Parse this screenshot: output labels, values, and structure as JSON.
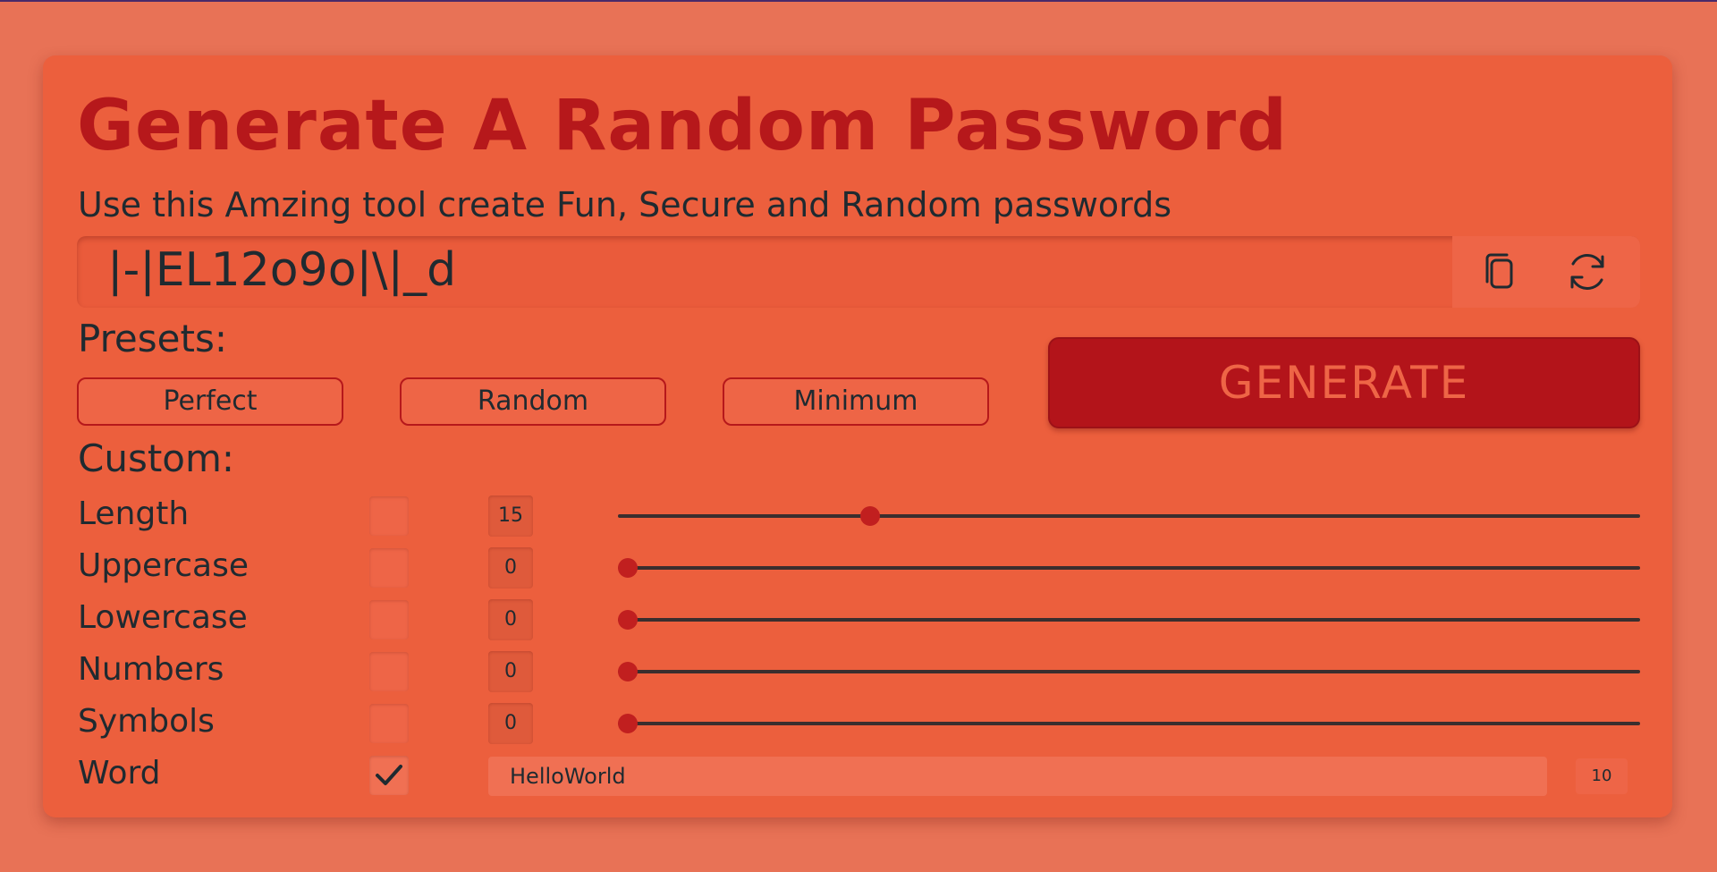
{
  "header": {
    "title": "Generate A Random Password",
    "subtitle": "Use this Amzing tool create Fun, Secure and Random passwords"
  },
  "password": {
    "value": "|-|EL12o9o|\\|_d",
    "copy_icon": "copy-icon",
    "refresh_icon": "refresh-icon"
  },
  "presets": {
    "label": "Presets:",
    "items": [
      "Perfect",
      "Random",
      "Minimum"
    ]
  },
  "generate_label": "GENERATE",
  "custom": {
    "label": "Custom:",
    "rows": [
      {
        "label": "Length",
        "checked": false,
        "value": "15",
        "slider_fraction": 0.242
      },
      {
        "label": "Uppercase",
        "checked": false,
        "value": "0",
        "slider_fraction": 0.0
      },
      {
        "label": "Lowercase",
        "checked": false,
        "value": "0",
        "slider_fraction": 0.0
      },
      {
        "label": "Numbers",
        "checked": false,
        "value": "0",
        "slider_fraction": 0.0
      },
      {
        "label": "Symbols",
        "checked": false,
        "value": "0",
        "slider_fraction": 0.0
      }
    ],
    "word": {
      "label": "Word",
      "checked": true,
      "value": "HelloWorld",
      "count": "10"
    }
  },
  "colors": {
    "background": "#e87256",
    "card": "#ec5f3d",
    "accent": "#b6181b",
    "text": "#1f2a30"
  }
}
